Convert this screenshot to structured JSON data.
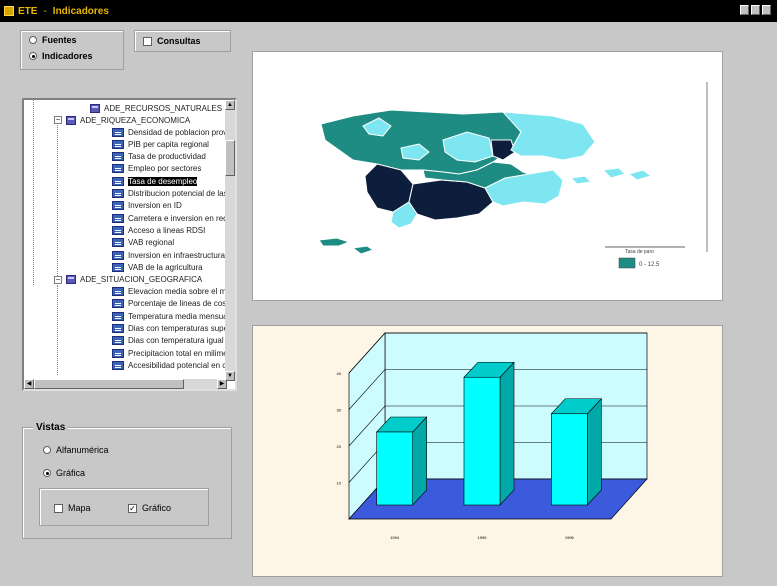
{
  "window": {
    "app_name": "ETE",
    "separator": "-",
    "title": "Indicadores"
  },
  "source": {
    "options": [
      {
        "label": "Fuentes",
        "selected": false
      },
      {
        "label": "Indicadores",
        "selected": true
      }
    ]
  },
  "consultas": {
    "label": "Consultas",
    "checked": false
  },
  "tree": {
    "groups": [
      {
        "label": "ADE_RECURSOS_NATURALES",
        "expanded": false,
        "items": []
      },
      {
        "label": "ADE_RIQUEZA_ECONOMICA",
        "expanded": true,
        "items": [
          "Densidad de poblacion provi",
          "PIB per capita regional",
          "Tasa de productividad",
          "Empleo por sectores",
          "Tasa de desempleo",
          "Distribucion potencial de las",
          "Inversion en ID",
          "Carretera e inversion en red",
          "Acceso a lineas RDSI",
          "VAB regional",
          "Inversion en infraestructuras",
          "VAB de la agricultura"
        ],
        "selected_index": 4
      },
      {
        "label": "ADE_SITUACION_GEOGRAFICA",
        "expanded": true,
        "items": [
          "Elevacion media sobre el ma",
          "Porcentaje de lineas de costa",
          "Temperatura media mensual",
          "Dias con temperaturas super",
          "Dias con temperatura igual o",
          "Precipitacion total en milimetr",
          "Accesibilidad potencial en c"
        ]
      }
    ]
  },
  "vistas": {
    "title": "Vistas",
    "options": [
      {
        "label": "Alfanumérica",
        "selected": false
      },
      {
        "label": "Gráfica",
        "selected": true
      }
    ],
    "checks": [
      {
        "label": "Mapa",
        "checked": false
      },
      {
        "label": "Gráfico",
        "checked": true
      }
    ]
  },
  "map": {
    "legend": {
      "title": "Tasa de paro",
      "label": "0 - 12.5"
    },
    "colors": {
      "dark": "#0d1e3c",
      "teal": "#1e8c82",
      "light": "#7ee6f0",
      "background": "#ffffff"
    }
  },
  "chart_data": {
    "type": "bar",
    "categories": [
      "1994",
      "1995",
      "1996"
    ],
    "values": [
      20,
      35,
      25
    ],
    "ylim": [
      0,
      40
    ],
    "ytick_labels": [
      "10",
      "20",
      "30",
      "40"
    ],
    "grid": true,
    "colors": {
      "bar_front": "#00ffff",
      "bar_side": "#00a8a8",
      "bar_top": "#00cccc",
      "floor": "#3c5adc",
      "wall": "#cdfcff"
    }
  }
}
